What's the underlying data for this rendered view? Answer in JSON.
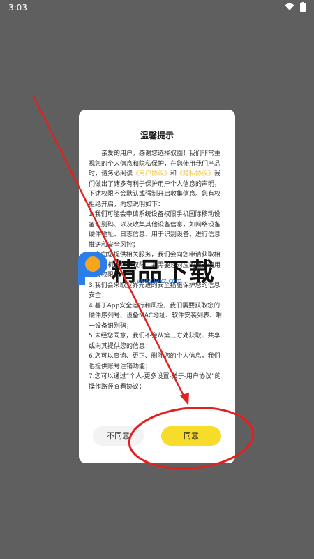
{
  "status_bar": {
    "time": "3:03",
    "icons": [
      "wifi-icon",
      "battery-icon"
    ]
  },
  "dialog": {
    "title": "温馨提示",
    "intro_1": "亲爱的用户，感谢您选择驭圈！我们非常重视您的个人信息和隐私保护，在您使用我们产品时，请务必阅读",
    "user_agreement_link": "《用户协议》",
    "and": "和",
    "privacy_link": "《隐私协议》",
    "intro_2": "我们做出了诸多有利于保护用户个人信息的声明，下述权限不会默认或强制开启收集信息。您有权拒绝开启，向您说明如下：",
    "items": [
      "1.我们可能会申请系统设备权限手机国际移动设备识别码、以及收集其他设备信息，如网络设备硬件地址、日志信息、用于识别设备，进行信息推送和安全风控；",
      "2.为向您提供相关服务，我们会向您申请获取相册、相机、存储权限，并需要您对应的业务使用相关权限；",
      "3.我们会采取业界先进的安全措施保护您的信息安全；",
      "4.基于App安全运行和风控，我们需要获取您的硬件序列号、设备MAC地址、软件安装列表、唯一设备识别码；",
      "5.未经您同意，我们不会从第三方处获取、共享或向其提供您的信息；",
      "6.您可以查询、更正、删除您的个人信息，我们也提供账号注销功能；",
      "7.您可以通过“个人-更多设置-关于-用户协议”的操作路径查看协议；"
    ],
    "disagree_label": "不同意",
    "agree_label": "同意"
  },
  "watermark": {
    "text": "精品下载",
    "url": "www.jpxz.com"
  },
  "colors": {
    "background": "#5f5f5f",
    "link": "#f1c232",
    "agree_button": "#f7dc2a",
    "annotation": "#e32020",
    "watermark_blue": "#2b7de9",
    "watermark_orange": "#f7a51c"
  }
}
